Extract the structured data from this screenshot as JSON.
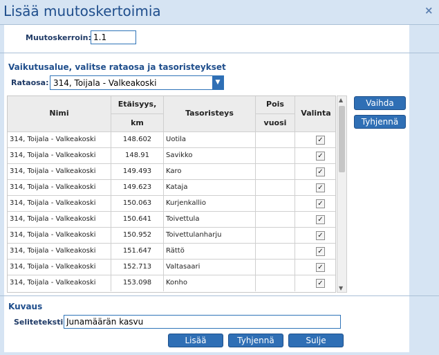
{
  "dialog": {
    "title": "Lisää muutoskertoimia",
    "close_icon": "×"
  },
  "factor": {
    "label": "Muutoskerroin:",
    "value": "1.1"
  },
  "area": {
    "heading": "Vaikutusalue, valitse rataosa ja tasoristeykset",
    "section_label": "Rataosa:",
    "section_value": "314, Toijala - Valkeakoski"
  },
  "side_buttons": {
    "change": "Vaihda",
    "clear": "Tyhjennä"
  },
  "table": {
    "headers": {
      "name": "Nimi",
      "distance_line1": "Etäisyys,",
      "distance_line2": "km",
      "crossing": "Tasoristeys",
      "removed_line1": "Pois",
      "removed_line2": "vuosi",
      "select": "Valinta"
    },
    "rows": [
      {
        "name": "314, Toijala - Valkeakoski",
        "distance": "148.602",
        "crossing": "Uotila",
        "removed": "",
        "checked": "✓"
      },
      {
        "name": "314, Toijala - Valkeakoski",
        "distance": "148.91",
        "crossing": "Savikko",
        "removed": "",
        "checked": "✓"
      },
      {
        "name": "314, Toijala - Valkeakoski",
        "distance": "149.493",
        "crossing": "Karo",
        "removed": "",
        "checked": "✓"
      },
      {
        "name": "314, Toijala - Valkeakoski",
        "distance": "149.623",
        "crossing": "Kataja",
        "removed": "",
        "checked": "✓"
      },
      {
        "name": "314, Toijala - Valkeakoski",
        "distance": "150.063",
        "crossing": "Kurjenkallio",
        "removed": "",
        "checked": "✓"
      },
      {
        "name": "314, Toijala - Valkeakoski",
        "distance": "150.641",
        "crossing": "Toivettula",
        "removed": "",
        "checked": "✓"
      },
      {
        "name": "314, Toijala - Valkeakoski",
        "distance": "150.952",
        "crossing": "Toivettulanharju",
        "removed": "",
        "checked": "✓"
      },
      {
        "name": "314, Toijala - Valkeakoski",
        "distance": "151.647",
        "crossing": "Rättö",
        "removed": "",
        "checked": "✓"
      },
      {
        "name": "314, Toijala - Valkeakoski",
        "distance": "152.713",
        "crossing": "Valtasaari",
        "removed": "",
        "checked": "✓"
      },
      {
        "name": "314, Toijala - Valkeakoski",
        "distance": "153.098",
        "crossing": "Konho",
        "removed": "",
        "checked": "✓"
      }
    ]
  },
  "description": {
    "heading": "Kuvaus",
    "label": "Seliteteksti:",
    "value": "Junamäärän kasvu"
  },
  "footer": {
    "add": "Lisää",
    "clear": "Tyhjennä",
    "close": "Sulje"
  },
  "colors": {
    "accent": "#2f6fb5",
    "title": "#1f4e8c",
    "background": "#d6e4f3"
  }
}
